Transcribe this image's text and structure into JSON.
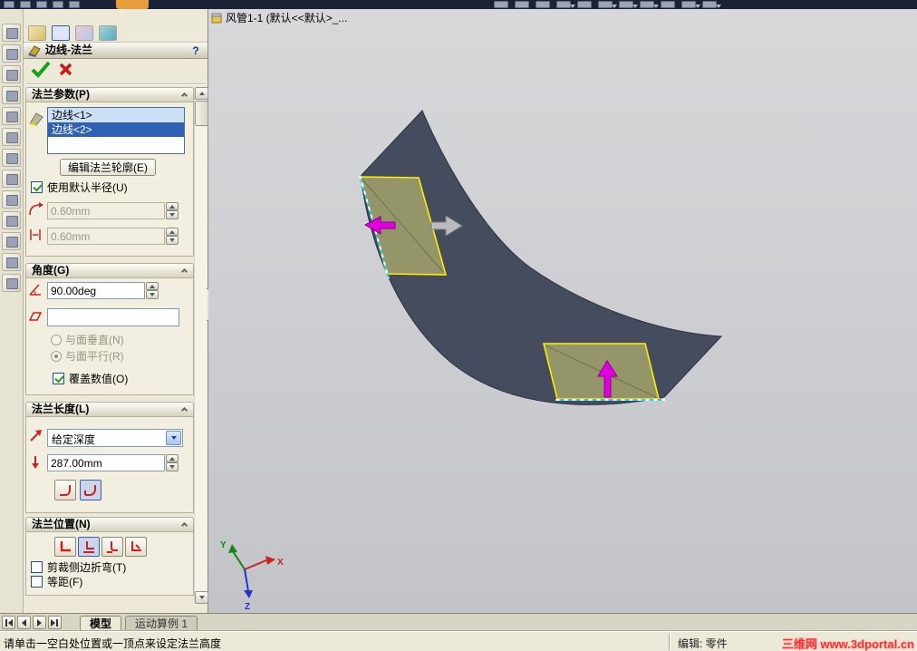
{
  "colors": {
    "selection_yellow": "#ffee00",
    "preview_olive": "#a2a26b",
    "arrow_magenta": "#e000e0",
    "model_slate": "#454c5e",
    "panel_beige": "#ece9d8",
    "watermark_red": "#ff3232"
  },
  "property_manager": {
    "title": "边线-法兰",
    "help_label": "?",
    "flange_params": {
      "header": "法兰参数(P)",
      "edges": [
        "边线<1>",
        "边线<2>"
      ],
      "edit_profile_button": "编辑法兰轮廓(E)",
      "use_default_radius_label": "使用默认半径(U)",
      "bend_radius_value": "0.60mm",
      "gap_distance_value": "0.60mm"
    },
    "angle": {
      "header": "角度(G)",
      "angle_value": "90.00deg",
      "face_value": "",
      "perpendicular_label": "与面垂直(N)",
      "parallel_label": "与面平行(R)",
      "override_label": "覆盖数值(O)"
    },
    "flange_length": {
      "header": "法兰长度(L)",
      "end_condition_value": "给定深度",
      "depth_value": "287.00mm"
    },
    "flange_position": {
      "header": "法兰位置(N)",
      "trim_side_bends_label": "剪裁侧边折弯(T)",
      "offset_label": "等距(F)"
    }
  },
  "viewport": {
    "flyout_tree_label": "风管1-1 (默认<<默认>_...",
    "triad": {
      "x_label": "X",
      "y_label": "Y",
      "z_label": "Z"
    },
    "watermark": "三维网 www.3dportal.cn"
  },
  "bottom_tabs": {
    "model": "模型",
    "motion_study": "运动算例 1"
  },
  "status_bar": {
    "message": "请单击一空白处位置或一顶点来设定法兰高度",
    "mode": "编辑: 零件"
  }
}
